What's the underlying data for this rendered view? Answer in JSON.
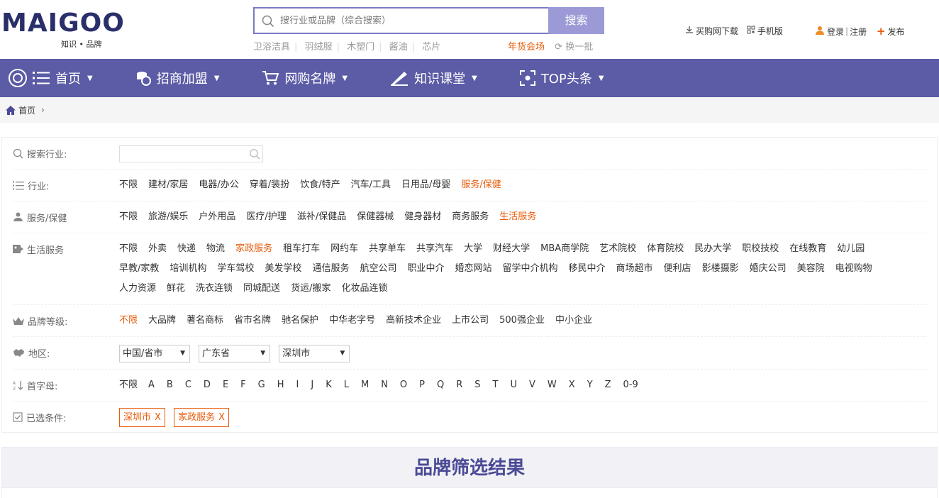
{
  "header": {
    "logo": {
      "brand": "MAIGOO",
      "subtitle": "知识 • 品牌"
    },
    "search": {
      "placeholder": "搜行业或品牌（综合搜索）",
      "button_label": "搜索"
    },
    "hot_links": [
      "卫浴洁具",
      "羽绒服",
      "木塑门",
      "酱油",
      "芯片"
    ],
    "sale_label": "年货会场",
    "refresh_label": "换一批",
    "app_download_label": "买购网下载",
    "mobile_label": "手机版",
    "login_label": "登录",
    "register_label": "注册",
    "publish_label": "发布"
  },
  "nav": {
    "items": [
      {
        "label": "首页"
      },
      {
        "label": "招商加盟"
      },
      {
        "label": "网购名牌"
      },
      {
        "label": "知识课堂"
      },
      {
        "label": "TOP头条"
      }
    ]
  },
  "breadcrumb": {
    "home_label": "首页"
  },
  "filters": {
    "industry_search_label": "搜索行业:",
    "industry": {
      "label": "行业:",
      "options": [
        "不限",
        "建材/家居",
        "电器/办公",
        "穿着/装扮",
        "饮食/特产",
        "汽车/工具",
        "日用品/母婴",
        "服务/保健"
      ],
      "selected": "服务/保健"
    },
    "service": {
      "label": "服务/保健",
      "options": [
        "不限",
        "旅游/娱乐",
        "户外用品",
        "医疗/护理",
        "滋补/保健品",
        "保健器械",
        "健身器材",
        "商务服务",
        "生活服务"
      ],
      "selected": "生活服务"
    },
    "life_service": {
      "label": "生活服务",
      "options": [
        "不限",
        "外卖",
        "快递",
        "物流",
        "家政服务",
        "租车打车",
        "网约车",
        "共享单车",
        "共享汽车",
        "大学",
        "财经大学",
        "MBA商学院",
        "艺术院校",
        "体育院校",
        "民办大学",
        "职校技校",
        "在线教育",
        "幼儿园",
        "早教/家教",
        "培训机构",
        "学车驾校",
        "美发学校",
        "通信服务",
        "航空公司",
        "职业中介",
        "婚恋网站",
        "留学中介机构",
        "移民中介",
        "商场超市",
        "便利店",
        "影楼摄影",
        "婚庆公司",
        "美容院",
        "电视购物",
        "人力资源",
        "鲜花",
        "洗衣连锁",
        "同城配送",
        "货运/搬家",
        "化妆品连锁"
      ],
      "selected": "家政服务"
    },
    "brand_level": {
      "label": "品牌等级:",
      "options": [
        "不限",
        "大品牌",
        "著名商标",
        "省市名牌",
        "驰名保护",
        "中华老字号",
        "高新技术企业",
        "上市公司",
        "500强企业",
        "中小企业"
      ],
      "selected": "不限"
    },
    "region": {
      "label": "地区:",
      "selects": [
        "中国/省市",
        "广东省",
        "深圳市"
      ]
    },
    "initial": {
      "label": "首字母:",
      "options": [
        "不限",
        "A",
        "B",
        "C",
        "D",
        "E",
        "F",
        "G",
        "H",
        "I",
        "J",
        "K",
        "L",
        "M",
        "N",
        "O",
        "P",
        "Q",
        "R",
        "S",
        "T",
        "U",
        "V",
        "W",
        "X",
        "Y",
        "Z",
        "0-9"
      ]
    },
    "selected_conditions": {
      "label": "已选条件:",
      "chips": [
        "深圳市",
        "家政服务"
      ],
      "remove_symbol": "X"
    }
  },
  "result": {
    "title": "品牌筛选结果"
  },
  "colors": {
    "nav_bg": "#5b5ba6",
    "accent": "#e85c0c",
    "search_btn": "#9b9ad6",
    "logo": "#2a2f6a"
  }
}
